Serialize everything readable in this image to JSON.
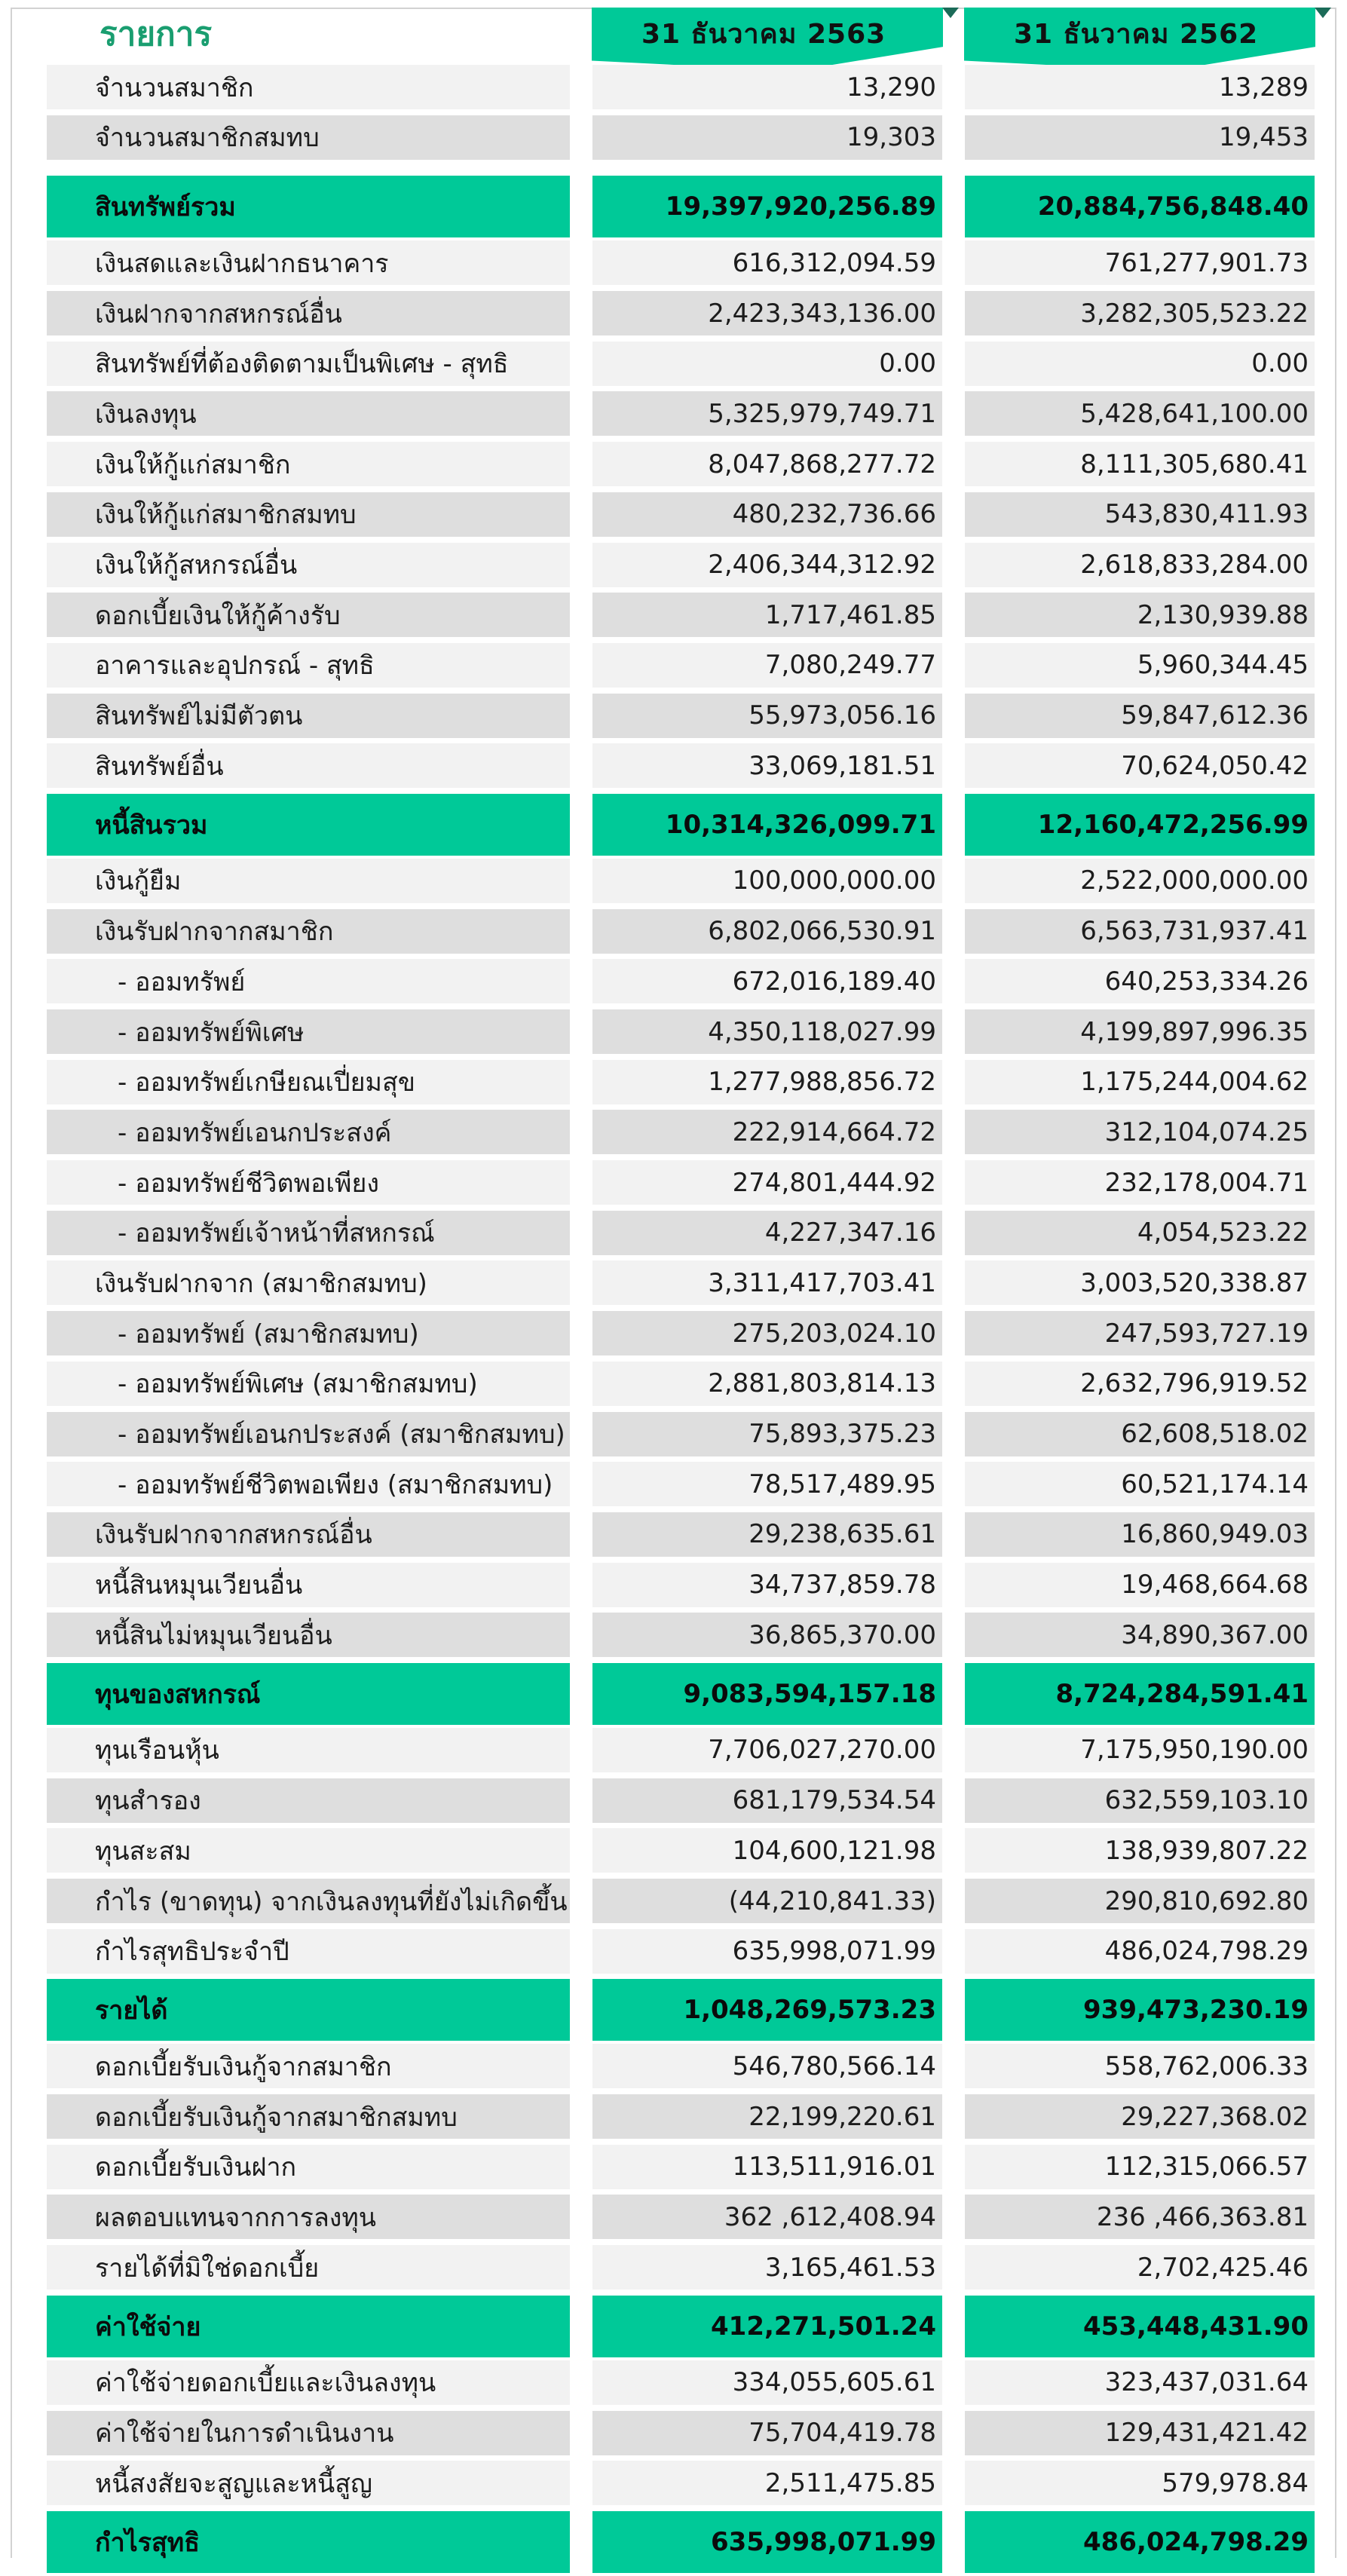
{
  "header": {
    "title": "รายการ",
    "col1": "31  ธันวาคม  2563",
    "col2": "31  ธันวาคม  2562"
  },
  "rows": [
    {
      "label": "จำนวนสมาชิก",
      "v1": "13,290",
      "v2": "13,289",
      "style": "w"
    },
    {
      "label": "จำนวนสมาชิกสมทบ",
      "v1": "19,303",
      "v2": "19,453",
      "style": "g"
    },
    {
      "label": "สินทรัพย์รวม",
      "v1": "19,397,920,256.89",
      "v2": "20,884,756,848.40",
      "style": "s"
    },
    {
      "label": "เงินสดและเงินฝากธนาคาร",
      "v1": "616,312,094.59",
      "v2": "761,277,901.73",
      "style": "w"
    },
    {
      "label": "เงินฝากจากสหกรณ์อื่น",
      "v1": "2,423,343,136.00",
      "v2": "3,282,305,523.22",
      "style": "g"
    },
    {
      "label": "สินทรัพย์ที่ต้องติดตามเป็นพิเศษ - สุทธิ",
      "v1": "0.00",
      "v2": "0.00",
      "style": "w"
    },
    {
      "label": "เงินลงทุน",
      "v1": "5,325,979,749.71",
      "v2": "5,428,641,100.00",
      "style": "g"
    },
    {
      "label": "เงินให้กู้แก่สมาชิก",
      "v1": "8,047,868,277.72",
      "v2": "8,111,305,680.41",
      "style": "w"
    },
    {
      "label": "เงินให้กู้แก่สมาชิกสมทบ",
      "v1": "480,232,736.66",
      "v2": "543,830,411.93",
      "style": "g"
    },
    {
      "label": "เงินให้กู้สหกรณ์อื่น",
      "v1": "2,406,344,312.92",
      "v2": "2,618,833,284.00",
      "style": "w"
    },
    {
      "label": "ดอกเบี้ยเงินให้กู้ค้างรับ",
      "v1": "1,717,461.85",
      "v2": "2,130,939.88",
      "style": "g"
    },
    {
      "label": "อาคารและอุปกรณ์ - สุทธิ",
      "v1": "7,080,249.77",
      "v2": "5,960,344.45",
      "style": "w"
    },
    {
      "label": "สินทรัพย์ไม่มีตัวตน",
      "v1": "55,973,056.16",
      "v2": "59,847,612.36",
      "style": "g"
    },
    {
      "label": "สินทรัพย์อื่น",
      "v1": "33,069,181.51",
      "v2": "70,624,050.42",
      "style": "w"
    },
    {
      "label": "หนี้สินรวม",
      "v1": "10,314,326,099.71",
      "v2": "12,160,472,256.99",
      "style": "s"
    },
    {
      "label": "เงินกู้ยืม",
      "v1": "100,000,000.00",
      "v2": "2,522,000,000.00",
      "style": "w"
    },
    {
      "label": "เงินรับฝากจากสมาชิก",
      "v1": "6,802,066,530.91",
      "v2": "6,563,731,937.41",
      "style": "g"
    },
    {
      "label": "- ออมทรัพย์",
      "v1": "672,016,189.40",
      "v2": "640,253,334.26",
      "style": "w",
      "indent": true
    },
    {
      "label": "- ออมทรัพย์พิเศษ",
      "v1": "4,350,118,027.99",
      "v2": "4,199,897,996.35",
      "style": "g",
      "indent": true
    },
    {
      "label": "- ออมทรัพย์เกษียณเปี่ยมสุข",
      "v1": "1,277,988,856.72",
      "v2": "1,175,244,004.62",
      "style": "w",
      "indent": true
    },
    {
      "label": "- ออมทรัพย์เอนกประสงค์",
      "v1": "222,914,664.72",
      "v2": "312,104,074.25",
      "style": "g",
      "indent": true
    },
    {
      "label": "- ออมทรัพย์ชีวิตพอเพียง",
      "v1": "274,801,444.92",
      "v2": "232,178,004.71",
      "style": "w",
      "indent": true
    },
    {
      "label": "-  ออมทรัพย์เจ้าหน้าที่สหกรณ์",
      "v1": "4,227,347.16",
      "v2": "4,054,523.22",
      "style": "g",
      "indent": true
    },
    {
      "label": "เงินรับฝากจาก (สมาชิกสมทบ)",
      "v1": "3,311,417,703.41",
      "v2": "3,003,520,338.87",
      "style": "w"
    },
    {
      "label": "-  ออมทรัพย์ (สมาชิกสมทบ)",
      "v1": "275,203,024.10",
      "v2": "247,593,727.19",
      "style": "g",
      "indent": true
    },
    {
      "label": "-  ออมทรัพย์พิเศษ (สมาชิกสมทบ)",
      "v1": "2,881,803,814.13",
      "v2": "2,632,796,919.52",
      "style": "w",
      "indent": true
    },
    {
      "label": "-  ออมทรัพย์เอนกประสงค์ (สมาชิกสมทบ)",
      "v1": "75,893,375.23",
      "v2": "62,608,518.02",
      "style": "g",
      "indent": true
    },
    {
      "label": "-  ออมทรัพย์ชีวิตพอเพียง (สมาชิกสมทบ)",
      "v1": "78,517,489.95",
      "v2": "60,521,174.14",
      "style": "w",
      "indent": true
    },
    {
      "label": "เงินรับฝากจากสหกรณ์อื่น",
      "v1": "29,238,635.61",
      "v2": "16,860,949.03",
      "style": "g"
    },
    {
      "label": "หนี้สินหมุนเวียนอื่น",
      "v1": "34,737,859.78",
      "v2": "19,468,664.68",
      "style": "w"
    },
    {
      "label": "หนี้สินไม่หมุนเวียนอื่น",
      "v1": "36,865,370.00",
      "v2": "34,890,367.00",
      "style": "g"
    },
    {
      "label": "ทุนของสหกรณ์",
      "v1": "9,083,594,157.18",
      "v2": "8,724,284,591.41",
      "style": "s"
    },
    {
      "label": "ทุนเรือนหุ้น",
      "v1": "7,706,027,270.00",
      "v2": "7,175,950,190.00",
      "style": "w"
    },
    {
      "label": "ทุนสำรอง",
      "v1": "681,179,534.54",
      "v2": "632,559,103.10",
      "style": "g"
    },
    {
      "label": "ทุนสะสม",
      "v1": "104,600,121.98",
      "v2": "138,939,807.22",
      "style": "w"
    },
    {
      "label": "กำไร (ขาดทุน) จากเงินลงทุนที่ยังไม่เกิดขึ้น",
      "v1": "(44,210,841.33)",
      "v2": "290,810,692.80",
      "style": "g"
    },
    {
      "label": "กำไรสุทธิประจำปี",
      "v1": "635,998,071.99",
      "v2": "486,024,798.29",
      "style": "w"
    },
    {
      "label": "รายได้",
      "v1": "1,048,269,573.23",
      "v2": "939,473,230.19",
      "style": "s"
    },
    {
      "label": "ดอกเบี้ยรับเงินกู้จากสมาชิก",
      "v1": "546,780,566.14",
      "v2": "558,762,006.33",
      "style": "w"
    },
    {
      "label": "ดอกเบี้ยรับเงินกู้จากสมาชิกสมทบ",
      "v1": "22,199,220.61",
      "v2": "29,227,368.02",
      "style": "g"
    },
    {
      "label": "ดอกเบี้ยรับเงินฝาก",
      "v1": "113,511,916.01",
      "v2": "112,315,066.57",
      "style": "w"
    },
    {
      "label": "ผลตอบแทนจากการลงทุน",
      "v1": "362 ,612,408.94",
      "v2": "236 ,466,363.81",
      "style": "g"
    },
    {
      "label": "รายได้ที่มิใช่ดอกเบี้ย",
      "v1": "3,165,461.53",
      "v2": "2,702,425.46",
      "style": "w"
    },
    {
      "label": "ค่าใช้จ่าย",
      "v1": "412,271,501.24",
      "v2": "453,448,431.90",
      "style": "s"
    },
    {
      "label": "ค่าใช้จ่ายดอกเบี้ยและเงินลงทุน",
      "v1": "334,055,605.61",
      "v2": "323,437,031.64",
      "style": "w"
    },
    {
      "label": "ค่าใช้จ่ายในการดำเนินงาน",
      "v1": "75,704,419.78",
      "v2": "129,431,421.42",
      "style": "g"
    },
    {
      "label": "หนี้สงสัยจะสูญและหนี้สูญ",
      "v1": "2,511,475.85",
      "v2": "579,978.84",
      "style": "w"
    },
    {
      "label": "กำไรสุทธิ",
      "v1": "635,998,071.99",
      "v2": "486,024,798.29",
      "style": "s"
    }
  ],
  "colors": {
    "accent": "#00c998",
    "title": "#1a9e70",
    "row_light": "#f2f2f2",
    "row_dark": "#dedede"
  }
}
